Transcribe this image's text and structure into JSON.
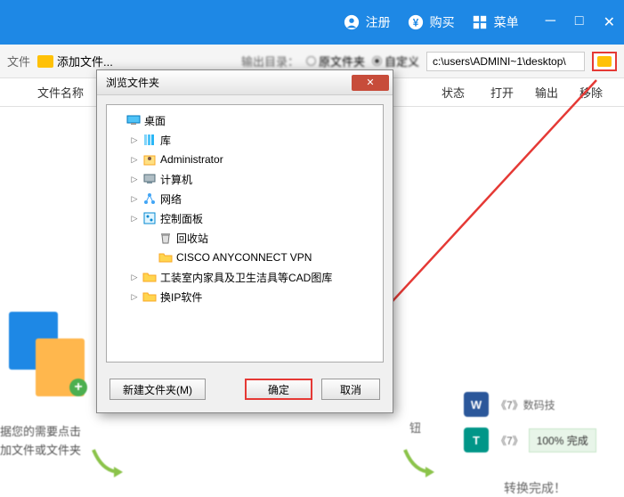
{
  "titlebar": {
    "register": "注册",
    "buy": "购买",
    "menu": "菜单"
  },
  "toolbar": {
    "file_label": "文件",
    "add_files": "添加文件...",
    "output_label": "输出目录：",
    "radio_original": "原文件夹",
    "radio_custom": "自定义",
    "path_value": "c:\\users\\ADMINI~1\\desktop\\"
  },
  "headers": {
    "filename": "文件名称",
    "status": "状态",
    "open": "打开",
    "output": "输出",
    "remove": "移除"
  },
  "leftHelp": {
    "line1": "据您的需要点击",
    "line2": "加文件或文件夹"
  },
  "centerHint": "钮",
  "rightPanel": {
    "file_w": "《7》数码技",
    "file_t": "《7》",
    "progress": "100%  完成",
    "done": "转换完成！"
  },
  "dialog": {
    "title": "浏览文件夹",
    "tree": [
      {
        "indent": 0,
        "exp": "",
        "icon": "desktop",
        "label": "桌面"
      },
      {
        "indent": 1,
        "exp": "▷",
        "icon": "library",
        "label": "库"
      },
      {
        "indent": 1,
        "exp": "▷",
        "icon": "user",
        "label": "Administrator"
      },
      {
        "indent": 1,
        "exp": "▷",
        "icon": "computer",
        "label": "计算机"
      },
      {
        "indent": 1,
        "exp": "▷",
        "icon": "network",
        "label": "网络"
      },
      {
        "indent": 1,
        "exp": "▷",
        "icon": "control",
        "label": "控制面板"
      },
      {
        "indent": 2,
        "exp": "",
        "icon": "recycle",
        "label": "回收站"
      },
      {
        "indent": 2,
        "exp": "",
        "icon": "folder",
        "label": "CISCO ANYCONNECT VPN"
      },
      {
        "indent": 1,
        "exp": "▷",
        "icon": "folder",
        "label": "工装室内家具及卫生洁具等CAD图库"
      },
      {
        "indent": 1,
        "exp": "▷",
        "icon": "folder",
        "label": "换IP软件"
      }
    ],
    "btn_new": "新建文件夹(M)",
    "btn_ok": "确定",
    "btn_cancel": "取消"
  }
}
